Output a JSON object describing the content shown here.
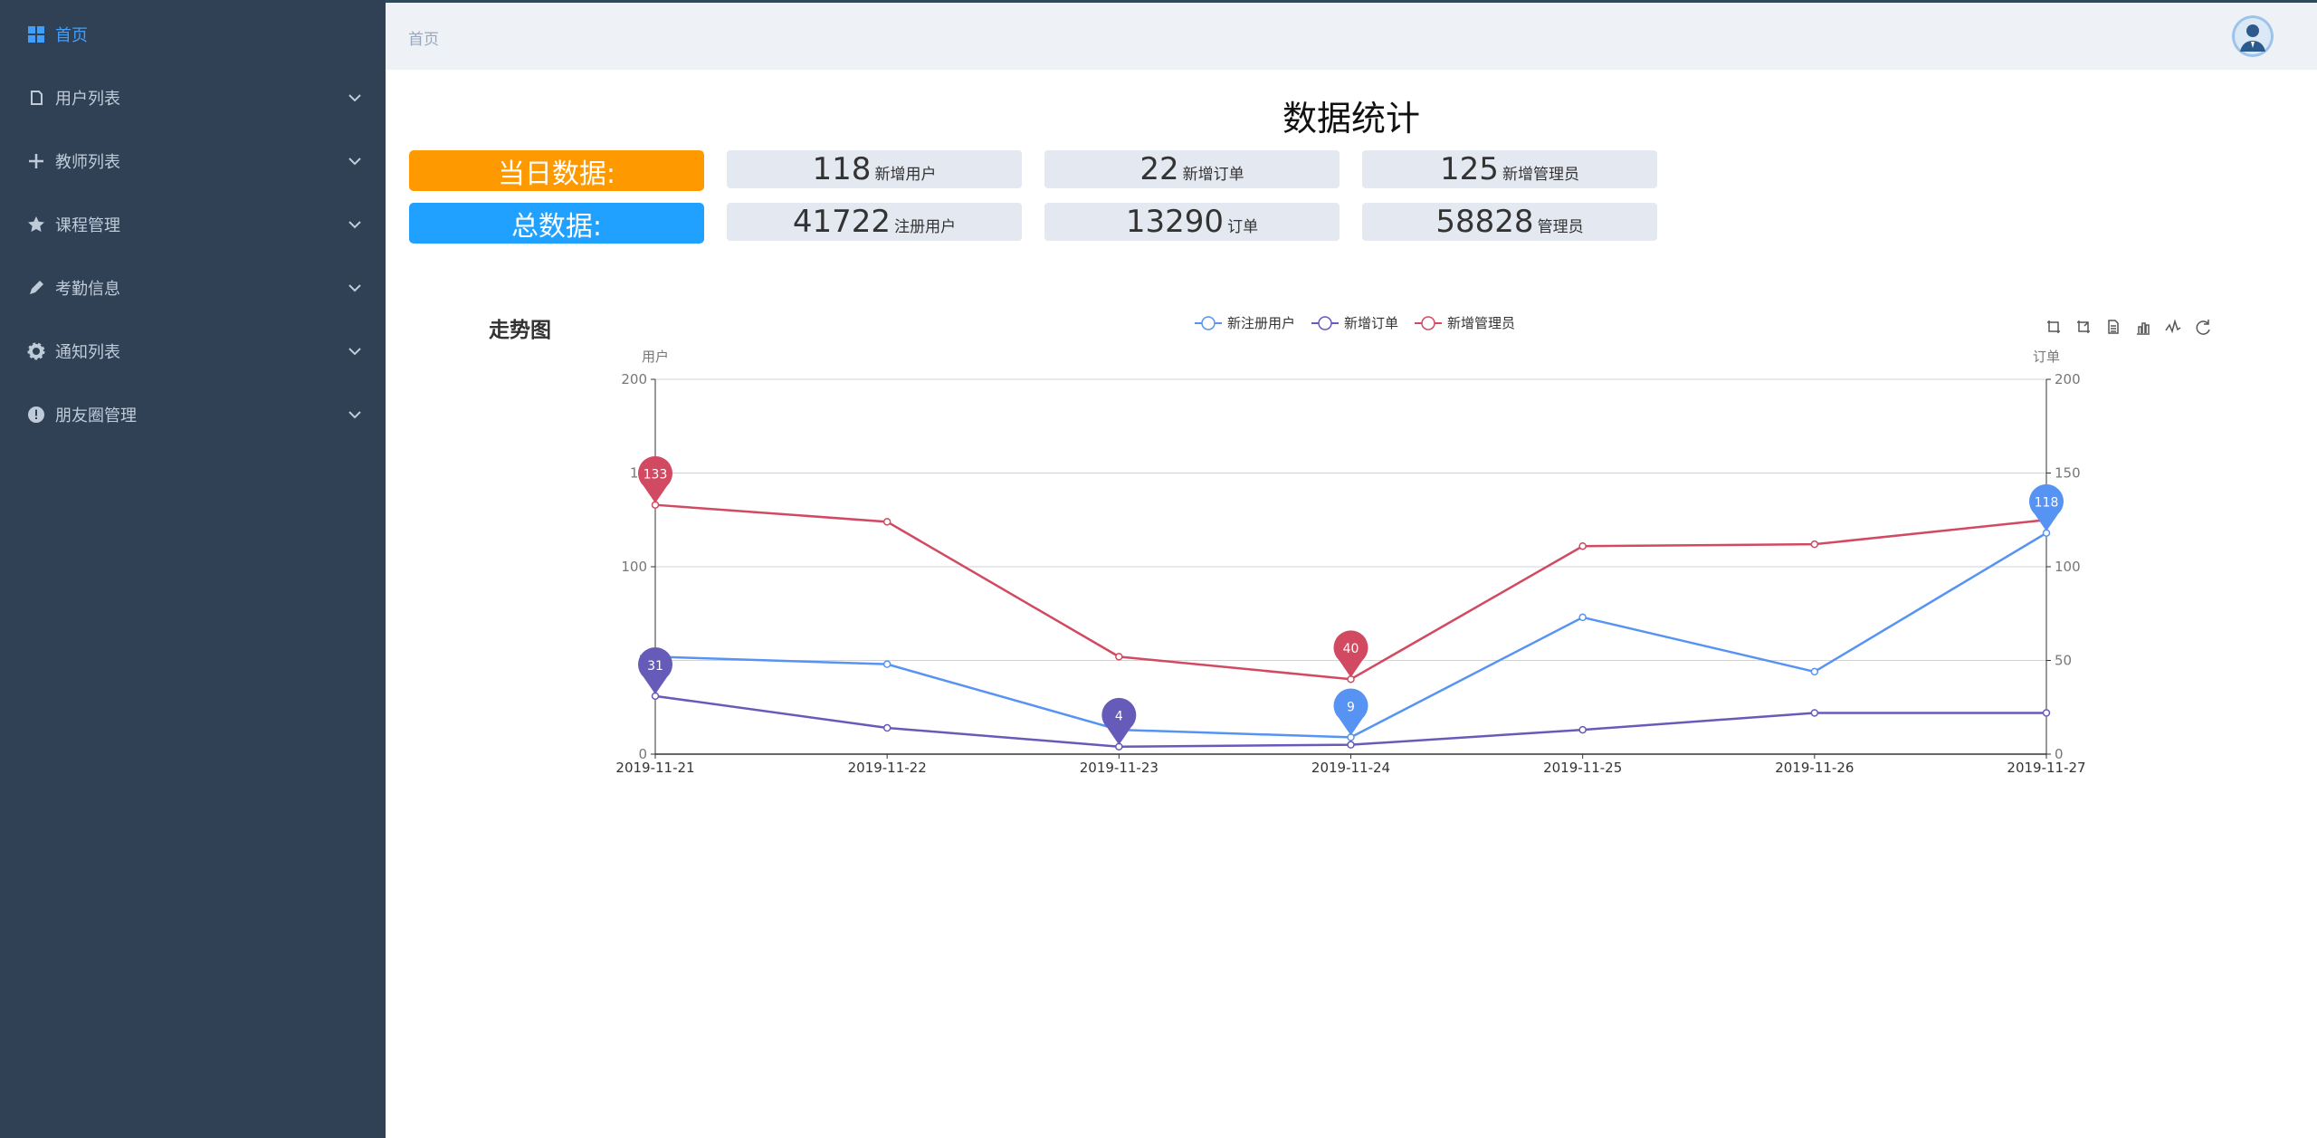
{
  "sidebar": {
    "items": [
      {
        "label": "首页",
        "icon": "dashboard-icon",
        "active": true
      },
      {
        "label": "用户列表",
        "icon": "document-icon"
      },
      {
        "label": "教师列表",
        "icon": "plus-icon"
      },
      {
        "label": "课程管理",
        "icon": "star-icon"
      },
      {
        "label": "考勤信息",
        "icon": "edit-icon"
      },
      {
        "label": "通知列表",
        "icon": "gear-icon"
      },
      {
        "label": "朋友圈管理",
        "icon": "info-icon"
      }
    ]
  },
  "header": {
    "breadcrumb": "首页",
    "avatar_icon": "user-avatar-icon"
  },
  "stats": {
    "title": "数据统计",
    "today": {
      "label": "当日数据:",
      "items": [
        {
          "value": "118",
          "unit": "新增用户"
        },
        {
          "value": "22",
          "unit": "新增订单"
        },
        {
          "value": "125",
          "unit": "新增管理员"
        }
      ]
    },
    "total": {
      "label": "总数据:",
      "items": [
        {
          "value": "41722",
          "unit": "注册用户"
        },
        {
          "value": "13290",
          "unit": "订单"
        },
        {
          "value": "58828",
          "unit": "管理员"
        }
      ]
    }
  },
  "colors": {
    "sidebar_bg": "#304156",
    "active": "#409eff",
    "orange": "#ff9900",
    "blue": "#20a0ff",
    "series_users": "#5793f3",
    "series_orders": "#675bba",
    "series_admins": "#d14a61"
  },
  "chart_data": {
    "type": "line",
    "title": "走势图",
    "x": [
      "2019-11-21",
      "2019-11-22",
      "2019-11-23",
      "2019-11-24",
      "2019-11-25",
      "2019-11-26",
      "2019-11-27"
    ],
    "y_left_label": "用户",
    "y_right_label": "订单",
    "ylim": [
      0,
      200
    ],
    "y_ticks": [
      "0",
      "50",
      "100",
      "150",
      "200"
    ],
    "y_ticks_left": [
      "0",
      "5",
      "100",
      "15",
      "200"
    ],
    "grid": true,
    "legend_position": "top-center",
    "toolbox_icons": [
      "zoom-icon",
      "zoom-reset-icon",
      "data-view-icon",
      "bar-chart-icon",
      "line-chart-icon",
      "restore-icon"
    ],
    "series": [
      {
        "name": "新注册用户",
        "color": "#5793f3",
        "values": [
          52,
          48,
          13,
          9,
          73,
          44,
          118
        ],
        "markers": [
          {
            "index": 6,
            "label": "118"
          },
          {
            "index": 3,
            "label": "9"
          }
        ]
      },
      {
        "name": "新增订单",
        "color": "#675bba",
        "values": [
          31,
          14,
          4,
          5,
          13,
          22,
          22
        ],
        "markers": [
          {
            "index": 0,
            "label": "31"
          },
          {
            "index": 2,
            "label": "4"
          }
        ]
      },
      {
        "name": "新增管理员",
        "color": "#d14a61",
        "values": [
          133,
          124,
          52,
          40,
          111,
          112,
          125
        ],
        "markers": [
          {
            "index": 0,
            "label": "133"
          },
          {
            "index": 3,
            "label": "40"
          }
        ]
      }
    ]
  }
}
